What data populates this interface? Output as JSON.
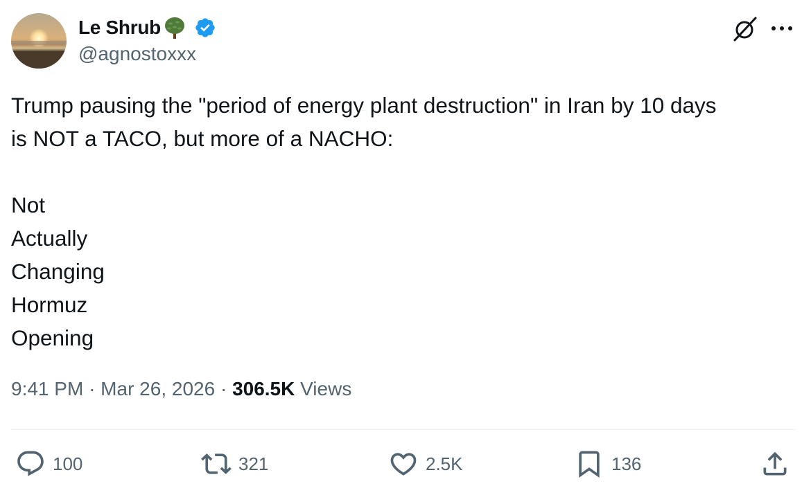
{
  "author": {
    "name": "Le Shrub",
    "handle": "@agnostoxxx",
    "name_emoji": "tree-emoji",
    "verified_badge": "verified-badge-icon"
  },
  "header_actions": {
    "grok_icon": "grok-icon",
    "more_icon": "more-icon"
  },
  "tweet": {
    "lines": [
      "Trump pausing the \"period of energy plant destruction\" in Iran by 10 days",
      "is NOT a TACO, but more of a NACHO:",
      "",
      "Not",
      "Actually",
      "Changing",
      "Hormuz",
      "Opening"
    ]
  },
  "meta": {
    "time": "9:41 PM",
    "date": "Mar 26, 2026",
    "separator": "·",
    "views_count": "306.5K",
    "views_label": "Views"
  },
  "actions": {
    "replies": "100",
    "retweets": "321",
    "likes": "2.5K",
    "bookmarks": "136"
  },
  "colors": {
    "text_primary": "#0f1419",
    "text_secondary": "#536471",
    "verified_blue": "#1d9bf0",
    "divider": "#eff3f4"
  }
}
